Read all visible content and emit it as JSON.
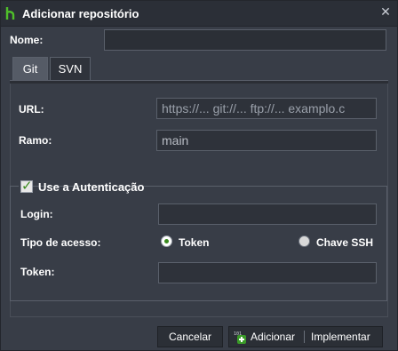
{
  "dialog": {
    "title": "Adicionar repositório",
    "title_icon": "git-branch-icon",
    "close_icon": "close-icon",
    "close_glyph": "✕"
  },
  "name_field": {
    "label": "Nome:",
    "value": ""
  },
  "tabs": [
    {
      "label": "Git",
      "active": true
    },
    {
      "label": "SVN",
      "active": false
    }
  ],
  "url_field": {
    "label": "URL:",
    "placeholder": "https://... git://... ftp://... examplo.c"
  },
  "branch_field": {
    "label": "Ramo:",
    "value": "main"
  },
  "auth": {
    "checkbox_checked": true,
    "checkbox_glyph": "✓",
    "legend": "Use a Autenticação",
    "login_label": "Login:",
    "login_value": "",
    "access_type_label": "Tipo de acesso:",
    "options": [
      {
        "label": "Token",
        "selected": true
      },
      {
        "label": "Chave SSH",
        "selected": false
      }
    ],
    "token_label": "Token:",
    "token_value": ""
  },
  "buttons": {
    "cancel": "Cancelar",
    "add": "Adicionar",
    "implement": "Implementar",
    "add_icon": "add-repo-icon"
  },
  "colors": {
    "accent_green": "#3a8a1e",
    "background": "#383d47"
  }
}
